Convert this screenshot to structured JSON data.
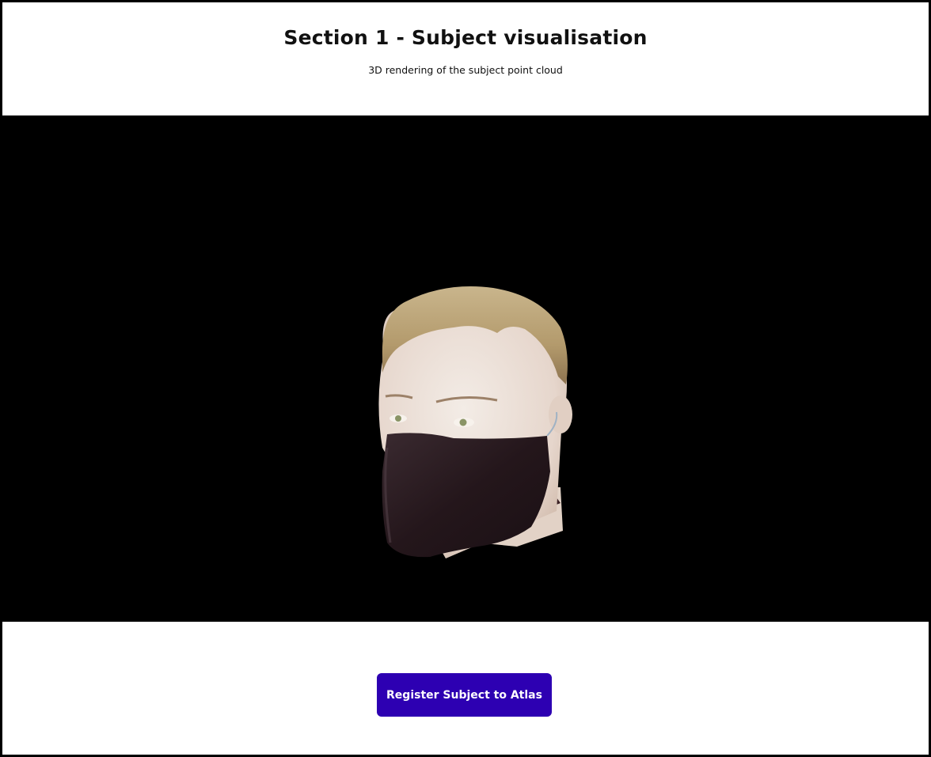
{
  "section": {
    "title": "Section 1 - Subject visualisation",
    "subtitle": "3D rendering of the subject point cloud"
  },
  "viewer": {
    "background": "#000000",
    "content": "subject-point-cloud-render"
  },
  "actions": {
    "register_label": "Register Subject to Atlas",
    "register_color": "#2d00b2"
  }
}
